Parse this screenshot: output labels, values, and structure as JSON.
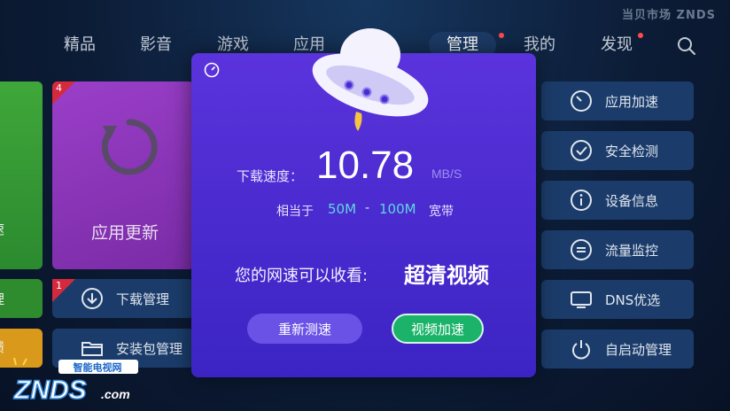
{
  "brand_top": "当贝市场 ZNDS",
  "nav": {
    "items": [
      "精品",
      "影音",
      "游戏",
      "应用",
      "管理",
      "我的",
      "发现"
    ],
    "active": "管理"
  },
  "tiles": {
    "left_edge_1": "速",
    "left_edge_2": "理",
    "left_edge_3": "馈",
    "app_update": {
      "badge": "4",
      "label": "应用更新"
    },
    "download": {
      "badge": "1",
      "label": "下载管理"
    },
    "package": {
      "label": "安装包管理"
    }
  },
  "right_menu": [
    {
      "label": "应用加速",
      "icon": "speed-icon"
    },
    {
      "label": "安全检测",
      "icon": "check-icon"
    },
    {
      "label": "设备信息",
      "icon": "info-icon"
    },
    {
      "label": "流量监控",
      "icon": "traffic-icon"
    },
    {
      "label": "DNS优选",
      "icon": "dns-icon"
    },
    {
      "label": "自启动管理",
      "icon": "power-icon"
    }
  ],
  "modal": {
    "speed_label": "下载速度：",
    "speed_value": "10.78",
    "speed_unit": "MB/S",
    "equiv_prefix": "相当于",
    "equiv_low": "50M",
    "equiv_dash": "-",
    "equiv_high": "100M",
    "equiv_suffix": "宽带",
    "watch_text": "您的网速可以收看:",
    "watch_value": "超清视频",
    "retest_button": "重新测速",
    "boost_button": "视频加速"
  },
  "logo": {
    "top": "智能电视网",
    "main": "ZNDS",
    "suffix": ".com"
  },
  "colors": {
    "modal": "#4a2bcf",
    "accent_cyan": "#5fd7e0",
    "boost_green": "#1bb36a",
    "tile_blue": "#1b3c6a",
    "tile_purple": "#8a35b8"
  }
}
